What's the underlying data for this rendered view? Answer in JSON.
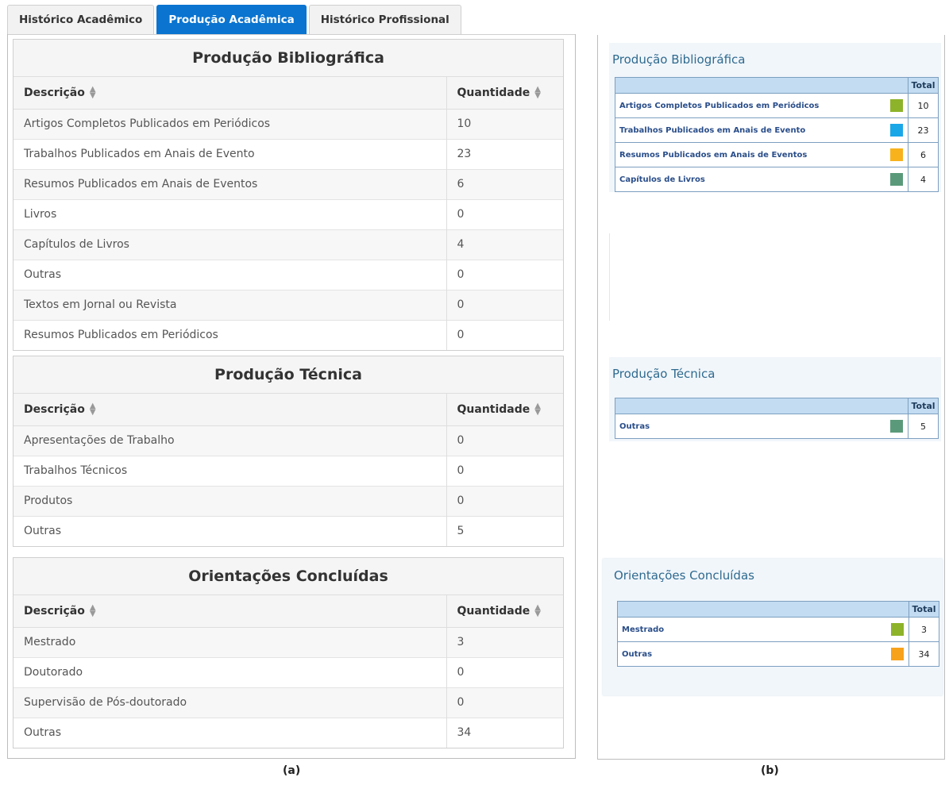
{
  "tabs": [
    {
      "label": "Histórico Acadêmico",
      "active": false
    },
    {
      "label": "Produção Acadêmica",
      "active": true
    },
    {
      "label": "Histórico Profissional",
      "active": false
    }
  ],
  "panel_a": {
    "column_description": "Descrição",
    "column_quantity": "Quantidade",
    "sections": [
      {
        "title": "Produção Bibliográfica",
        "rows": [
          {
            "description": "Artigos Completos Publicados em Periódicos",
            "quantity": "10"
          },
          {
            "description": "Trabalhos Publicados em Anais de Evento",
            "quantity": "23"
          },
          {
            "description": "Resumos Publicados em Anais de Eventos",
            "quantity": "6"
          },
          {
            "description": "Livros",
            "quantity": "0"
          },
          {
            "description": "Capítulos de Livros",
            "quantity": "4"
          },
          {
            "description": "Outras",
            "quantity": "0"
          },
          {
            "description": "Textos em Jornal ou Revista",
            "quantity": "0"
          },
          {
            "description": "Resumos Publicados em Periódicos",
            "quantity": "0"
          }
        ]
      },
      {
        "title": "Produção Técnica",
        "rows": [
          {
            "description": "Apresentações de Trabalho",
            "quantity": "0"
          },
          {
            "description": "Trabalhos Técnicos",
            "quantity": "0"
          },
          {
            "description": "Produtos",
            "quantity": "0"
          },
          {
            "description": "Outras",
            "quantity": "5"
          }
        ]
      },
      {
        "title": "Orientações Concluídas",
        "rows": [
          {
            "description": "Mestrado",
            "quantity": "3"
          },
          {
            "description": "Doutorado",
            "quantity": "0"
          },
          {
            "description": "Supervisão de Pós-doutorado",
            "quantity": "0"
          },
          {
            "description": "Outras",
            "quantity": "34"
          }
        ]
      }
    ]
  },
  "panel_b": {
    "total_header": "Total",
    "sections": [
      {
        "title": "Produção Bibliográfica",
        "rows": [
          {
            "label": "Artigos Completos Publicados em Periódicos",
            "color": "#8db32a",
            "total": "10"
          },
          {
            "label": "Trabalhos Publicados em Anais de Evento",
            "color": "#1aa7e8",
            "total": "23"
          },
          {
            "label": "Resumos Publicados em Anais de Eventos",
            "color": "#f7b21c",
            "total": "6"
          },
          {
            "label": "Capítulos de Livros",
            "color": "#5a9a7a",
            "total": "4"
          }
        ]
      },
      {
        "title": "Produção Técnica",
        "rows": [
          {
            "label": "Outras",
            "color": "#5a9a7a",
            "total": "5"
          }
        ]
      },
      {
        "title": "Orientações Concluídas",
        "rows": [
          {
            "label": "Mestrado",
            "color": "#8db32a",
            "total": "3"
          },
          {
            "label": "Outras",
            "color": "#f7a21c",
            "total": "34"
          }
        ]
      }
    ]
  },
  "captions": {
    "a": "(a)",
    "b": "(b)"
  }
}
